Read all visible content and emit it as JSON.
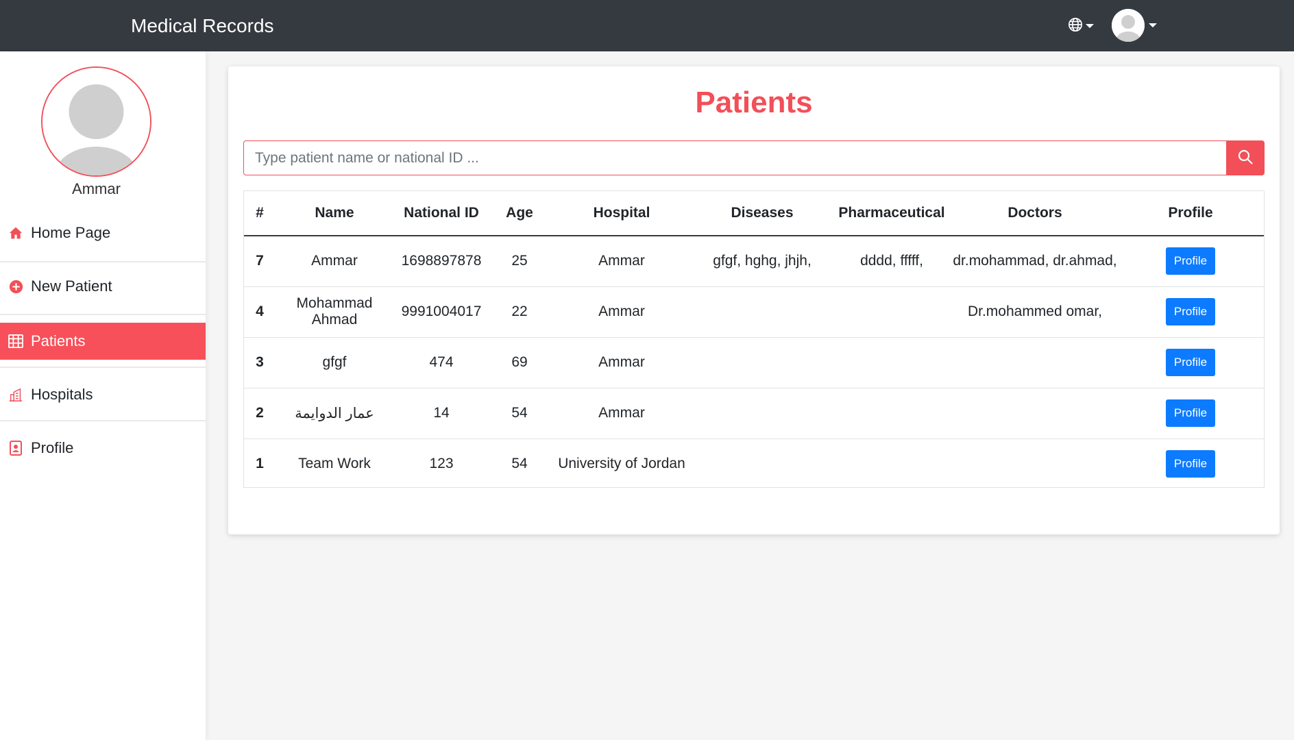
{
  "navbar": {
    "brand": "Medical Records",
    "language_icon": "globe-icon",
    "user_icon": "user-avatar-icon"
  },
  "sidebar": {
    "username": "Ammar",
    "items": [
      {
        "label": "Home Page",
        "icon": "home-icon",
        "active": false
      },
      {
        "label": "New Patient",
        "icon": "plus-circle-icon",
        "active": false
      },
      {
        "label": "Patients",
        "icon": "table-icon",
        "active": true
      },
      {
        "label": "Hospitals",
        "icon": "building-icon",
        "active": false
      },
      {
        "label": "Profile",
        "icon": "id-card-icon",
        "active": false
      }
    ]
  },
  "main": {
    "title": "Patients",
    "search": {
      "placeholder": "Type patient name or national ID ...",
      "icon": "search-icon"
    },
    "table": {
      "headers": [
        "#",
        "Name",
        "National ID",
        "Age",
        "Hospital",
        "Diseases",
        "Pharmaceutical",
        "Doctors",
        "Profile"
      ],
      "rows": [
        {
          "num": "7",
          "name": "Ammar",
          "national_id": "1698897878",
          "age": "25",
          "hospital": "Ammar",
          "diseases": "gfgf, hghg, jhjh,",
          "pharmaceutical": "dddd, fffff,",
          "doctors": "dr.mohammad, dr.ahmad,",
          "profile_label": "Profile"
        },
        {
          "num": "4",
          "name": "Mohammad Ahmad",
          "national_id": "9991004017",
          "age": "22",
          "hospital": "Ammar",
          "diseases": "",
          "pharmaceutical": "",
          "doctors": "Dr.mohammed omar,",
          "profile_label": "Profile"
        },
        {
          "num": "3",
          "name": "gfgf",
          "national_id": "474",
          "age": "69",
          "hospital": "Ammar",
          "diseases": "",
          "pharmaceutical": "",
          "doctors": "",
          "profile_label": "Profile"
        },
        {
          "num": "2",
          "name": "عمار الدوايمة",
          "national_id": "14",
          "age": "54",
          "hospital": "Ammar",
          "diseases": "",
          "pharmaceutical": "",
          "doctors": "",
          "profile_label": "Profile"
        },
        {
          "num": "1",
          "name": "Team Work",
          "national_id": "123",
          "age": "54",
          "hospital": "University of Jordan",
          "diseases": "",
          "pharmaceutical": "",
          "doctors": "",
          "profile_label": "Profile"
        }
      ]
    }
  },
  "colors": {
    "navbar_bg": "#343a40",
    "accent": "#f24f58",
    "button_blue": "#0d7bff"
  }
}
